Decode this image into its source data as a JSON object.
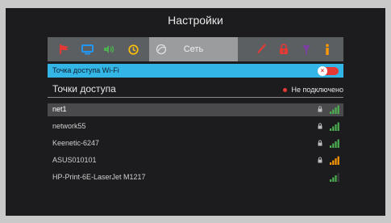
{
  "header": {
    "title": "Настройки"
  },
  "tabs": [
    {
      "icon": "flag-icon",
      "color": "#e53935"
    },
    {
      "icon": "monitor-icon",
      "color": "#2196f3"
    },
    {
      "icon": "speaker-icon",
      "color": "#4caf50"
    },
    {
      "icon": "clock-icon",
      "color": "#ffc107"
    },
    {
      "icon": "network-icon",
      "color": "#cfcfcf",
      "label": "Сеть",
      "active": true
    },
    {
      "icon": "brush-icon",
      "color": "#e53935"
    },
    {
      "icon": "lock-icon",
      "color": "#e53935"
    },
    {
      "icon": "pin-icon",
      "color": "#7b3fa0"
    },
    {
      "icon": "info-icon",
      "color": "#ff9800"
    }
  ],
  "wifi_ap": {
    "label": "Точка доступа Wi-Fi",
    "toggle_on": false
  },
  "access_points": {
    "title": "Точки доступа",
    "status": "Не подключено",
    "status_color": "#e53935",
    "items": [
      {
        "name": "net1",
        "locked": true,
        "signal": 4,
        "signal_color": "#4caf50",
        "selected": true
      },
      {
        "name": "network55",
        "locked": true,
        "signal": 4,
        "signal_color": "#4caf50"
      },
      {
        "name": "Keenetic-6247",
        "locked": true,
        "signal": 4,
        "signal_color": "#4caf50"
      },
      {
        "name": "ASUS010101",
        "locked": true,
        "signal": 4,
        "signal_color": "#ff9800"
      },
      {
        "name": "HP-Print-6E-LaserJet M1217",
        "locked": false,
        "signal": 3,
        "signal_color": "#4caf50"
      }
    ]
  }
}
